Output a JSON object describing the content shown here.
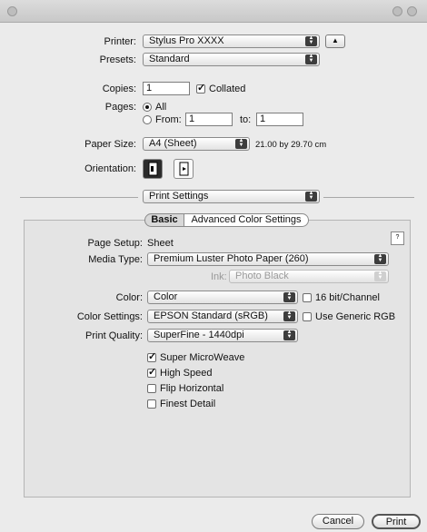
{
  "printer": {
    "label": "Printer:",
    "value": "Stylus Pro XXXX"
  },
  "presets": {
    "label": "Presets:",
    "value": "Standard"
  },
  "copies": {
    "label": "Copies:",
    "value": "1",
    "collated_label": "Collated",
    "collated_checked": true
  },
  "pages": {
    "label": "Pages:",
    "all_label": "All",
    "from_label": "From:",
    "from_value": "1",
    "to_label": "to:",
    "to_value": "1",
    "selected": "All"
  },
  "paper_size": {
    "label": "Paper Size:",
    "value": "A4 (Sheet)",
    "dimensions": "21.00 by 29.70 cm"
  },
  "orientation": {
    "label": "Orientation:",
    "options": [
      "portrait-icon",
      "landscape-icon"
    ],
    "selected": "portrait-icon"
  },
  "pane_selector": {
    "value": "Print Settings"
  },
  "tabs": {
    "items": [
      "Basic",
      "Advanced Color Settings"
    ],
    "selected": "Basic"
  },
  "settings": {
    "page_setup_label": "Page Setup:",
    "page_setup_value": "Sheet",
    "media_type_label": "Media Type:",
    "media_type_value": "Premium Luster Photo Paper (260)",
    "ink_label": "Ink:",
    "ink_value": "Photo Black",
    "color_label": "Color:",
    "color_value": "Color",
    "bit_label": "16 bit/Channel",
    "bit_checked": false,
    "color_settings_label": "Color Settings:",
    "color_settings_value": "EPSON Standard (sRGB)",
    "generic_rgb_label": "Use Generic RGB",
    "generic_rgb_checked": false,
    "print_quality_label": "Print Quality:",
    "print_quality_value": "SuperFine - 1440dpi",
    "options": [
      {
        "label": "Super MicroWeave",
        "checked": true
      },
      {
        "label": "High Speed",
        "checked": true
      },
      {
        "label": "Flip Horizontal",
        "checked": false
      },
      {
        "label": "Finest Detail",
        "checked": false
      }
    ]
  },
  "buttons": {
    "cancel": "Cancel",
    "print": "Print"
  }
}
